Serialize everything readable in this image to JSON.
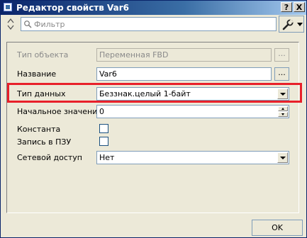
{
  "window": {
    "title": "Редактор свойств Var6",
    "help_label": "?",
    "close_label": "X"
  },
  "toolbar": {
    "filter_placeholder": "Фильтр"
  },
  "properties": {
    "object_type": {
      "label": "Тип объекта",
      "value": "Переменная FBD",
      "button": "...",
      "enabled": false
    },
    "name": {
      "label": "Название",
      "value": "Var6",
      "button": "..."
    },
    "data_type": {
      "label": "Тип данных",
      "value": "Беззнак.целый 1-байт"
    },
    "initial_value": {
      "label": "Начальное значение",
      "value": "0"
    },
    "constant": {
      "label": "Константа",
      "checked": false
    },
    "rom_write": {
      "label": "Запись в ПЗУ",
      "checked": false
    },
    "network_access": {
      "label": "Сетевой доступ",
      "value": "Нет"
    }
  },
  "footer": {
    "ok_label": "OK"
  },
  "colors": {
    "highlight": "#e8202a",
    "title_bar": "#0a246a"
  }
}
